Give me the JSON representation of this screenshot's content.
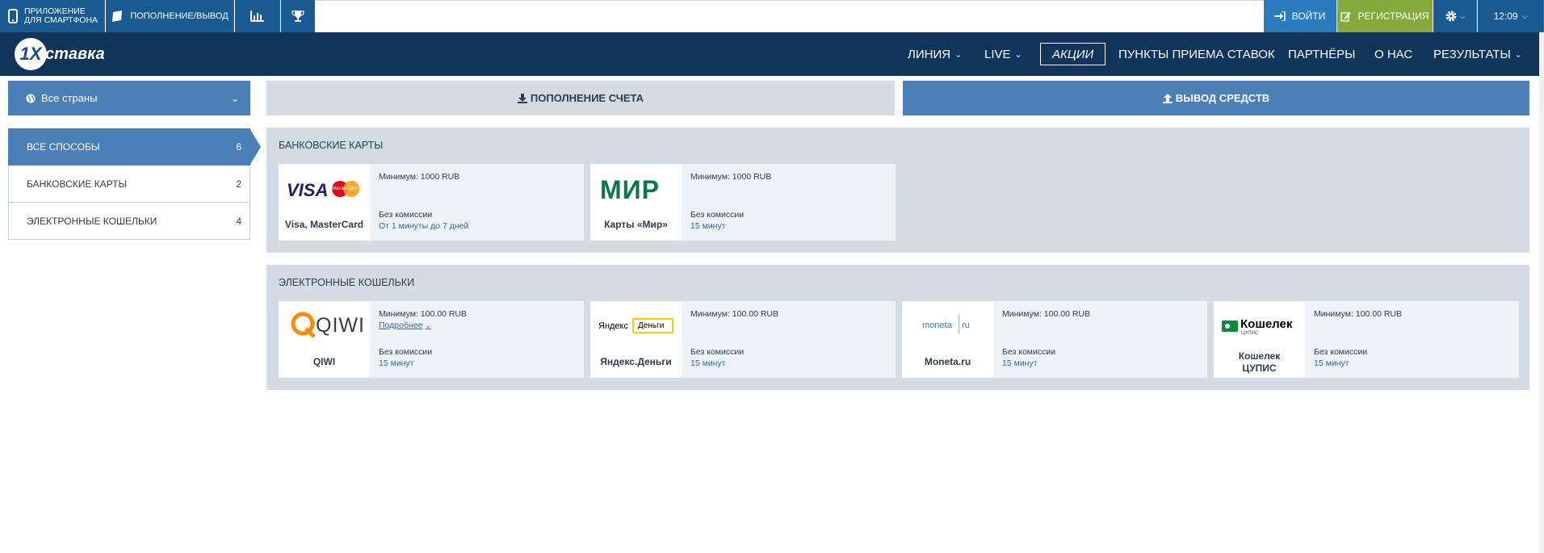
{
  "topbar": {
    "app_label_1": "Приложение",
    "app_label_2": "для смартфона",
    "deposit_label": "Пополнение/вывод",
    "login_label": "Войти",
    "register_label": "Регистрация",
    "time": "12:09"
  },
  "header": {
    "logo_1x": "1X",
    "logo_text": "ставка",
    "nav": [
      "Линия",
      "LIVE",
      "Акции",
      "Пункты приема ставок",
      "Партнёры",
      "О нас",
      "Результаты"
    ]
  },
  "country": {
    "label": "Все страны"
  },
  "sidebar": {
    "items": [
      {
        "label": "Все способы",
        "count": "6"
      },
      {
        "label": "Банковские карты",
        "count": "2"
      },
      {
        "label": "Электронные кошельки",
        "count": "4"
      }
    ]
  },
  "tabs": {
    "deposit": "Пополнение счета",
    "withdraw": "Вывод средств"
  },
  "sections": {
    "bank": {
      "title": "Банковские карты",
      "cards": [
        {
          "name": "Visa, MasterCard",
          "min": "Минимум: 1000 RUB",
          "commission": "Без комиссии",
          "time": "От 1 минуты до 7 дней"
        },
        {
          "name": "Карты «Мир»",
          "min": "Минимум: 1000 RUB",
          "commission": "Без комиссии",
          "time": "15 минут"
        }
      ]
    },
    "wallets": {
      "title": "Электронные кошельки",
      "cards": [
        {
          "name": "QIWI",
          "min": "Минимум: 100.00 RUB",
          "more": "Подробнее",
          "commission": "Без комиссии",
          "time": "15 минут"
        },
        {
          "name": "Яндекс.Деньги",
          "min": "Минимум: 100.00 RUB",
          "commission": "Без комиссии",
          "time": "15 минут"
        },
        {
          "name": "Moneta.ru",
          "min": "Минимум: 100.00 RUB",
          "commission": "Без комиссии",
          "time": "15 минут"
        },
        {
          "name_1": "Кошелек",
          "name_2": "ЦУПИС",
          "min": "Минимум: 100.00 RUB",
          "commission": "Без комиссии",
          "time": "15 минут"
        }
      ]
    }
  },
  "logos": {
    "visa": "VISA",
    "mastercard": "MasterCard",
    "mir": "МИР",
    "qiwi": "QIWI",
    "yandex": "Яндекс",
    "yandex_money": "Деньги",
    "moneta": "moneta",
    "moneta_ru": "ru",
    "cupis": "Кошелек",
    "cupis_sub": "ЦУПИС"
  },
  "colors": {
    "topbar": "#1a5a93",
    "header": "#11345b",
    "accent": "#4a80b5",
    "register": "#85a93b",
    "panel": "#d3dbe3"
  }
}
